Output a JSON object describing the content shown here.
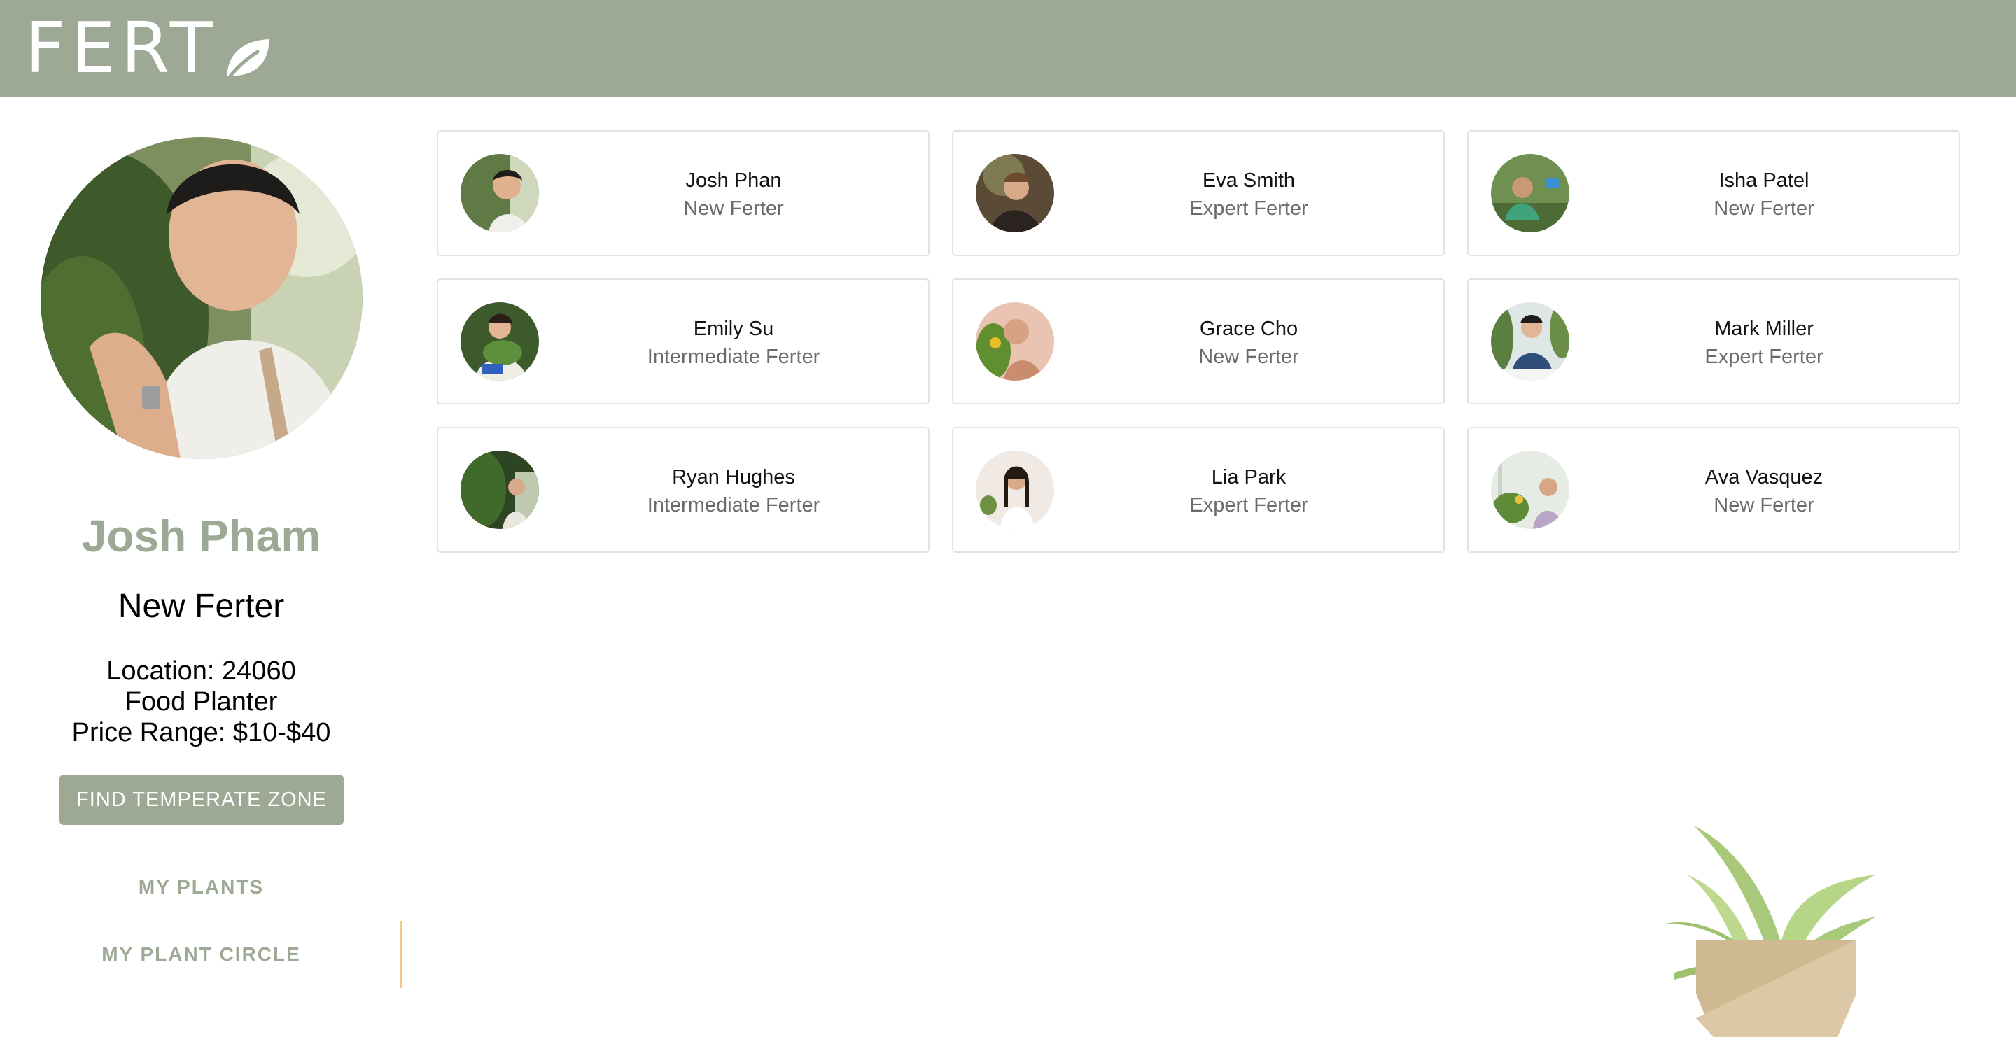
{
  "app": {
    "logo_text": "FERT"
  },
  "profile": {
    "name": "Josh Pham",
    "level": "New Ferter",
    "location": "Location: 24060",
    "planter_type": "Food Planter",
    "price_range": "Price Range: $10-$40"
  },
  "actions": {
    "find_zone_label": "FIND TEMPERATE ZONE"
  },
  "nav": {
    "my_plants": "MY PLANTS",
    "my_plant_circle": "MY PLANT CIRCLE",
    "active": "MY PLANT CIRCLE"
  },
  "circle": [
    {
      "name": "Josh Phan",
      "level": "New Ferter"
    },
    {
      "name": "Eva Smith",
      "level": "Expert Ferter"
    },
    {
      "name": "Isha Patel",
      "level": "New Ferter"
    },
    {
      "name": "Emily Su",
      "level": "Intermediate Ferter"
    },
    {
      "name": "Grace Cho",
      "level": "New Ferter"
    },
    {
      "name": "Mark Miller",
      "level": "Expert Ferter"
    },
    {
      "name": "Ryan Hughes",
      "level": "Intermediate Ferter"
    },
    {
      "name": "Lia Park",
      "level": "Expert Ferter"
    },
    {
      "name": "Ava Vasquez",
      "level": "New Ferter"
    }
  ],
  "colors": {
    "brand": "#9da895",
    "accent": "#f2c98a",
    "card_border": "#e2e2e2"
  }
}
